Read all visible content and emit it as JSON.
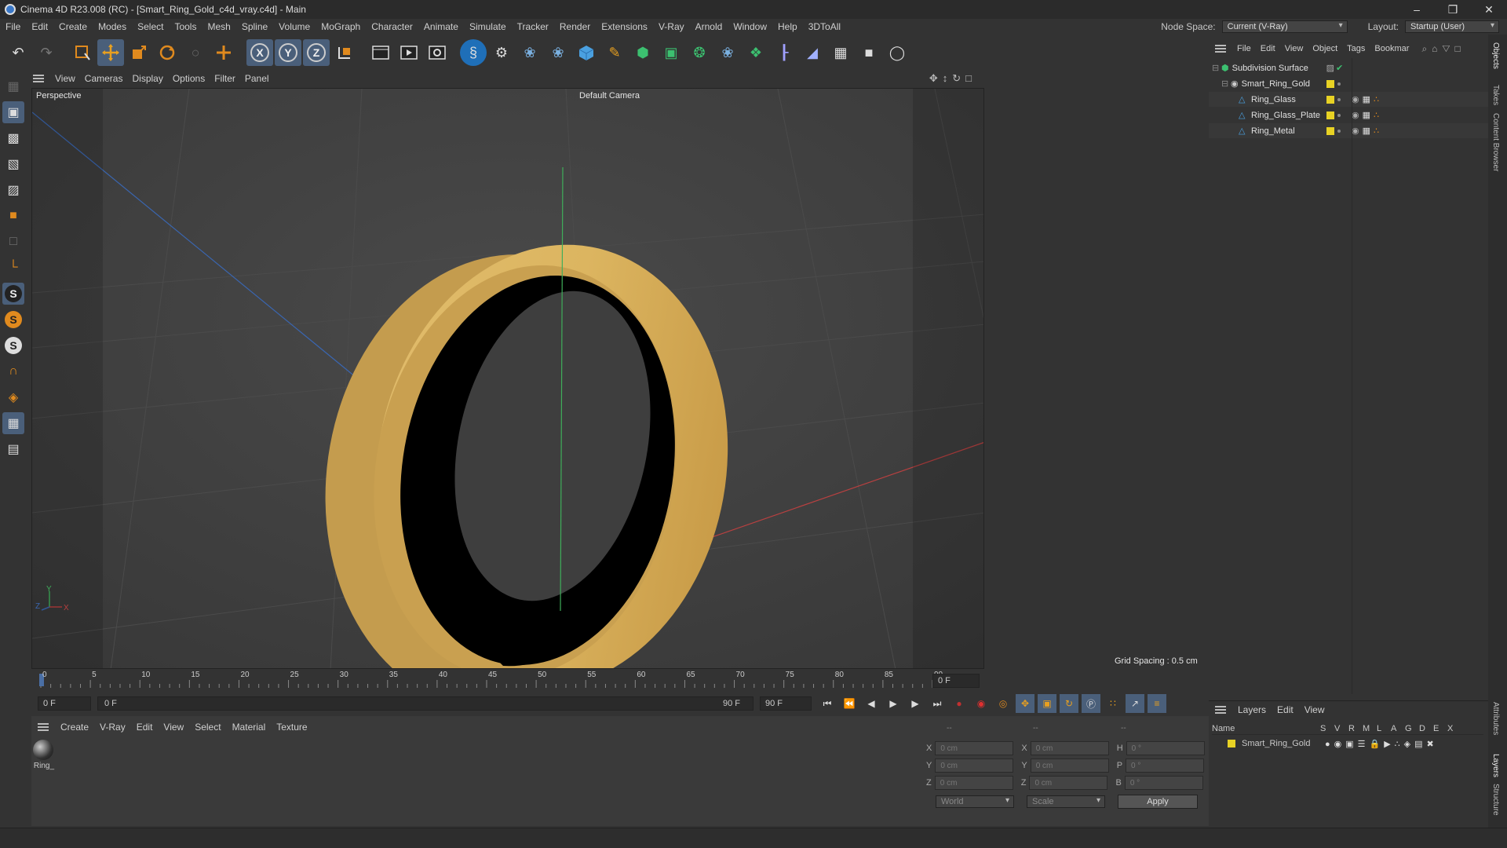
{
  "window": {
    "title": "Cinema 4D R23.008 (RC) - [Smart_Ring_Gold_c4d_vray.c4d] - Main",
    "min": "–",
    "max": "❒",
    "close": "✕"
  },
  "menubar": {
    "items": [
      "File",
      "Edit",
      "Create",
      "Modes",
      "Select",
      "Tools",
      "Mesh",
      "Spline",
      "Volume",
      "MoGraph",
      "Character",
      "Animate",
      "Simulate",
      "Tracker",
      "Render",
      "Extensions",
      "V-Ray",
      "Arnold",
      "Window",
      "Help",
      "3DToAll"
    ],
    "node_space_label": "Node Space:",
    "node_space_value": "Current (V-Ray)",
    "layout_label": "Layout:",
    "layout_value": "Startup (User)"
  },
  "toolbar": {
    "icons": [
      "undo-icon",
      "redo-icon",
      "live-select-icon",
      "move-icon",
      "scale-icon",
      "rotate-icon",
      "lasso-icon",
      "add-icon",
      "x-axis-icon",
      "y-axis-icon",
      "z-axis-icon",
      "coordinate-system-icon",
      "render-region-icon",
      "render-view-icon",
      "render-settings-icon",
      "vray-logo-icon",
      "cogwheel-icon",
      "python-icon",
      "python2-icon",
      "cube-icon",
      "pen-icon",
      "subdivision-icon",
      "extrude-icon",
      "cloner-icon",
      "python3-icon",
      "mograph-icon",
      "deformer-icon",
      "floor-icon",
      "camera-icon",
      "light-icon"
    ],
    "axis_x": "X",
    "axis_y": "Y",
    "axis_z": "Z"
  },
  "viewport": {
    "menu": [
      "View",
      "Cameras",
      "Display",
      "Options",
      "Filter",
      "Panel"
    ],
    "label": "Perspective",
    "camera": "Default Camera",
    "grid_spacing": "Grid Spacing : 0.5 cm",
    "axis_y": "Y",
    "axis_z": "Z",
    "axis_x": "X"
  },
  "timeline": {
    "ticks": [
      "0",
      "5",
      "10",
      "15",
      "20",
      "25",
      "30",
      "35",
      "40",
      "45",
      "50",
      "55",
      "60",
      "65",
      "70",
      "75",
      "80",
      "85",
      "90"
    ],
    "current_frame": "0 F"
  },
  "transport": {
    "start_field": "0 F",
    "range_start": "0 F",
    "range_end": "90 F",
    "end_field": "90 F"
  },
  "materials": {
    "menu": [
      "Create",
      "V-Ray",
      "Edit",
      "View",
      "Select",
      "Material",
      "Texture"
    ],
    "items": [
      {
        "label": "Ring_"
      }
    ]
  },
  "coords": {
    "header": [
      "--",
      "--",
      "--"
    ],
    "rows": [
      {
        "a": "X",
        "av": "0 cm",
        "b": "X",
        "bv": "0 cm",
        "c": "H",
        "cv": "0 °"
      },
      {
        "a": "Y",
        "av": "0 cm",
        "b": "Y",
        "bv": "0 cm",
        "c": "P",
        "cv": "0 °"
      },
      {
        "a": "Z",
        "av": "0 cm",
        "b": "Z",
        "bv": "0 cm",
        "c": "B",
        "cv": "0 °"
      }
    ],
    "space": "World",
    "mode": "Scale",
    "apply": "Apply"
  },
  "objects": {
    "menu": [
      "File",
      "Edit",
      "View",
      "Object",
      "Tags",
      "Bookmar"
    ],
    "tree": [
      {
        "name": "Subdivision Surface",
        "indent": 0
      },
      {
        "name": "Smart_Ring_Gold",
        "indent": 1
      },
      {
        "name": "Ring_Glass",
        "indent": 2
      },
      {
        "name": "Ring_Glass_Plate",
        "indent": 2
      },
      {
        "name": "Ring_Metal",
        "indent": 2
      }
    ]
  },
  "layers": {
    "menu": [
      "Layers",
      "Edit",
      "View"
    ],
    "columns": [
      "Name",
      "S",
      "V",
      "R",
      "M",
      "L",
      "A",
      "G",
      "D",
      "E",
      "X"
    ],
    "rows": [
      {
        "name": "Smart_Ring_Gold"
      }
    ]
  },
  "sidetabs": [
    "Objects",
    "Takes",
    "Content Browser",
    "Attributes",
    "Layers",
    "Structure"
  ],
  "colors": {
    "gold": "#dcb560",
    "accent": "#4a5f7a",
    "tag_yellow": "#e8d224"
  }
}
